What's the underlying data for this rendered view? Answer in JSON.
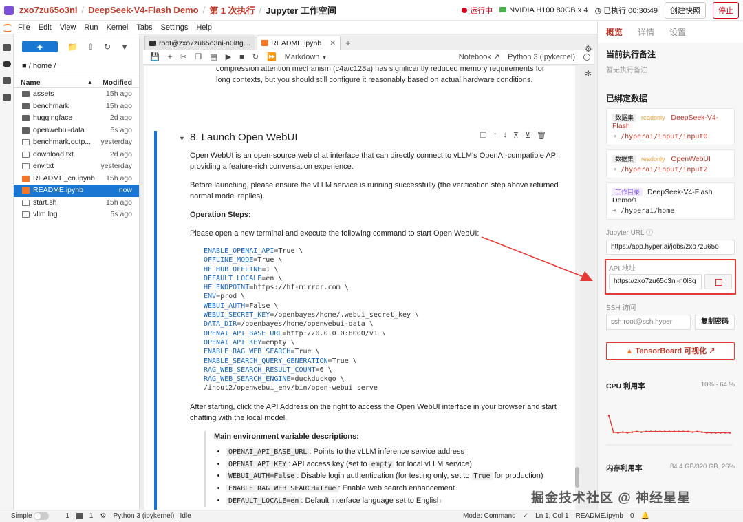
{
  "topbar": {
    "crumb1": "zxo7zu65o3ni",
    "crumb2": "DeepSeek-V4-Flash Demo",
    "crumb3": "第 1 次执行",
    "crumb4": "Jupyter 工作空间",
    "status": "运行中",
    "gpu": "NVIDIA H100 80GB x 4",
    "elapsed": "已执行 00:30:49",
    "snapshot_btn": "创建快照",
    "stop_btn": "停止"
  },
  "menu": [
    "File",
    "Edit",
    "View",
    "Run",
    "Kernel",
    "Tabs",
    "Settings",
    "Help"
  ],
  "filebrowser": {
    "new_label": "+",
    "path": "/ home /",
    "col_name": "Name",
    "col_modified": "Modified",
    "files": [
      {
        "name": "assets",
        "mod": "15h ago",
        "kind": "folder"
      },
      {
        "name": "benchmark",
        "mod": "15h ago",
        "kind": "folder"
      },
      {
        "name": "huggingface",
        "mod": "2d ago",
        "kind": "folder"
      },
      {
        "name": "openwebui-data",
        "mod": "5s ago",
        "kind": "folder"
      },
      {
        "name": "benchmark.outp...",
        "mod": "yesterday",
        "kind": "doc"
      },
      {
        "name": "download.txt",
        "mod": "2d ago",
        "kind": "doc"
      },
      {
        "name": "env.txt",
        "mod": "yesterday",
        "kind": "doc"
      },
      {
        "name": "README_cn.ipynb",
        "mod": "15h ago",
        "kind": "nb"
      },
      {
        "name": "README.ipynb",
        "mod": "now",
        "kind": "nb",
        "selected": true
      },
      {
        "name": "start.sh",
        "mod": "15h ago",
        "kind": "doc"
      },
      {
        "name": "vllm.log",
        "mod": "5s ago",
        "kind": "doc"
      }
    ]
  },
  "tabs": {
    "terminal": "root@zxo7zu65o3ni-n0l8g…",
    "notebook": "README.ipynb"
  },
  "nb_toolbar": {
    "cell_type": "Markdown",
    "notebook_btn": "Notebook",
    "kernel": "Python 3 (ipykernel)"
  },
  "cell": {
    "prev_line1": "compression attention mechanism (c4a/c128a) has significantly reduced memory requirements for",
    "prev_line2": "long contexts, but you should still configure it reasonably based on actual hardware conditions.",
    "heading": "8. Launch Open WebUI",
    "p1": "Open WebUI is an open-source web chat interface that can directly connect to vLLM's OpenAI-compatible API, providing a feature-rich conversation experience.",
    "p2": "Before launching, please ensure the vLLM service is running successfully (the verification step above returned normal model replies).",
    "steps_title": "Operation Steps:",
    "p3": "Please open a new terminal and execute the following command to start Open WebUI:",
    "code": [
      {
        "k": "ENABLE_OPENAI_API",
        "v": "=True \\"
      },
      {
        "k": "OFFLINE_MODE",
        "v": "=True \\"
      },
      {
        "k": "HF_HUB_OFFLINE",
        "v": "=1 \\"
      },
      {
        "k": "DEFAULT_LOCALE",
        "v": "=en \\"
      },
      {
        "k": "HF_ENDPOINT",
        "v": "=https://hf-mirror.com \\"
      },
      {
        "k": "ENV",
        "v": "=prod \\"
      },
      {
        "k": "WEBUI_AUTH",
        "v": "=False \\"
      },
      {
        "k": "WEBUI_SECRET_KEY",
        "v": "=/openbayes/home/.webui_secret_key \\"
      },
      {
        "k": "DATA_DIR",
        "v": "=/openbayes/home/openwebui-data \\"
      },
      {
        "k": "OPENAI_API_BASE_URL",
        "v": "=http://0.0.0.0:8000/v1 \\"
      },
      {
        "k": "OPENAI_API_KEY",
        "v": "=empty \\"
      },
      {
        "k": "ENABLE_RAG_WEB_SEARCH",
        "v": "=True \\"
      },
      {
        "k": "ENABLE_SEARCH_QUERY_GENERATION",
        "v": "=True \\"
      },
      {
        "k": "RAG_WEB_SEARCH_RESULT_COUNT",
        "v": "=6 \\"
      },
      {
        "k": "RAG_WEB_SEARCH_ENGINE",
        "v": "=duckduckgo \\"
      },
      {
        "k": "",
        "v": "/input2/openwebui_env/bin/open-webui serve"
      }
    ],
    "p4": "After starting, click the API Address on the right to access the Open WebUI interface in your browser and start chatting with the local model.",
    "note_title": "Main environment variable descriptions:",
    "bullets": [
      {
        "code": "OPENAI_API_BASE_URL",
        "text": ": Points to the vLLM inference service address"
      },
      {
        "code": "OPENAI_API_KEY",
        "text": ": API access key (set to ",
        "code2": "empty",
        "text2": " for local vLLM service)"
      },
      {
        "code": "WEBUI_AUTH=False",
        "text": ": Disable login authentication (for testing only, set to ",
        "code2": "True",
        "text2": " for production)"
      },
      {
        "code": "ENABLE_RAG_WEB_SEARCH=True",
        "text": ": Enable web search enhancement"
      },
      {
        "code": "DEFAULT_LOCALE=en",
        "text": ": Default interface language set to English"
      }
    ]
  },
  "rightpanel": {
    "tabs": [
      "概览",
      "详情",
      "设置"
    ],
    "notes_title": "当前执行备注",
    "notes_empty": "暂无执行备注",
    "data_title": "已绑定数据",
    "cards": [
      {
        "type": "数据集",
        "ro": "readonly",
        "name": "DeepSeek-V4-Flash",
        "path": "/hyperai/input/input0"
      },
      {
        "type": "数据集",
        "ro": "readonly",
        "name": "OpenWebUI",
        "path": "/hyperai/input/input2"
      },
      {
        "type": "工作目录",
        "ro": "",
        "name": "DeepSeek-V4-Flash Demo/1",
        "path": "/hyperai/home"
      }
    ],
    "jupyter_label": "Jupyter URL",
    "jupyter_url": "https://app.hyper.ai/jobs/zxo7zu65o",
    "api_label": "API 地址",
    "api_url": "https://zxo7zu65o3ni-n0l8g",
    "ssh_label": "SSH 访问",
    "ssh_value": "ssh root@ssh.hyper",
    "copy_btn": "复制密码",
    "tensorboard_btn": "TensorBoard 可视化",
    "cpu_title": "CPU 利用率",
    "cpu_value": "10% - 64 %",
    "mem_title": "内存利用率",
    "mem_value": "84.4 GB/320 GB, 26%"
  },
  "cpu_chart": {
    "type": "line",
    "values": [
      40,
      12,
      11,
      12,
      11,
      12,
      13,
      12,
      13,
      13,
      13,
      13,
      13,
      13,
      13,
      13,
      13,
      13,
      12,
      13,
      12,
      11,
      11,
      11,
      11,
      11,
      11
    ],
    "range": [
      10,
      64
    ]
  },
  "statusbar": {
    "mode_label": "Simple",
    "num1": "1",
    "num2": "1",
    "kernel": "Python 3 (ipykernel) | Idle",
    "mode": "Mode: Command",
    "position": "Ln 1, Col 1",
    "file": "README.ipynb",
    "count": "0"
  },
  "watermark": "掘金技术社区 @ 神经星星",
  "colors": {
    "accent": "#c0392b",
    "primary": "#1976d2",
    "highlight": "#e53935"
  }
}
